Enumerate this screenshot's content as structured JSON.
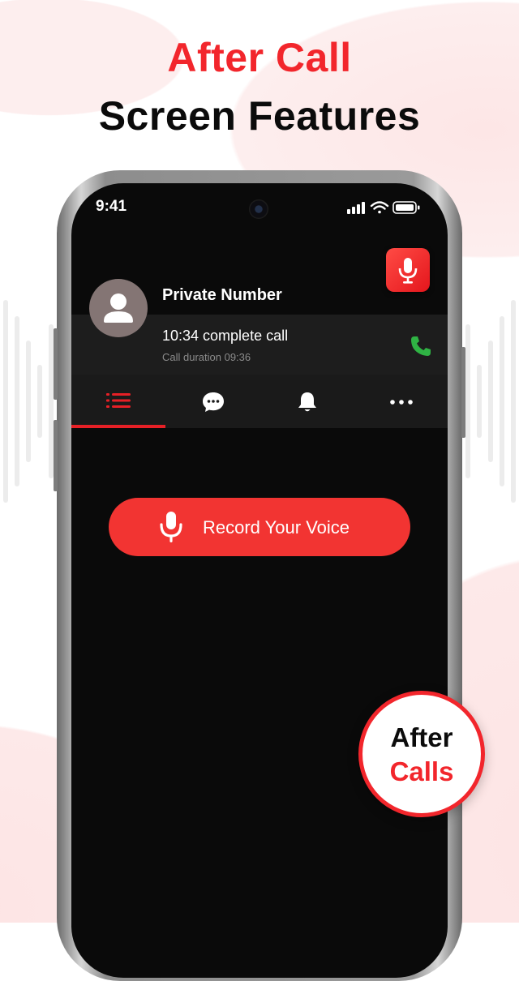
{
  "heading": {
    "line1": "After Call",
    "line2": "Screen Features"
  },
  "status_bar": {
    "time": "9:41",
    "icons": [
      "signal-icon",
      "wifi-icon",
      "battery-icon"
    ]
  },
  "caller": {
    "name": "Private Number",
    "summary": "10:34 complete call",
    "duration": "Call duration 09:36"
  },
  "tabs": [
    {
      "id": "list",
      "icon": "list-icon",
      "active": true
    },
    {
      "id": "messages",
      "icon": "chat-bubble-icon",
      "active": false
    },
    {
      "id": "reminders",
      "icon": "bell-icon",
      "active": false
    },
    {
      "id": "more",
      "icon": "more-dots-icon",
      "active": false
    }
  ],
  "record_button": {
    "label": "Record Your Voice",
    "icon": "microphone-icon"
  },
  "badge": {
    "line1": "After",
    "line2": "Calls"
  },
  "colors": {
    "accent": "#f2262c",
    "screen": "#0a0a0a",
    "panel": "#1d1d1d",
    "call_green": "#2fb344"
  }
}
